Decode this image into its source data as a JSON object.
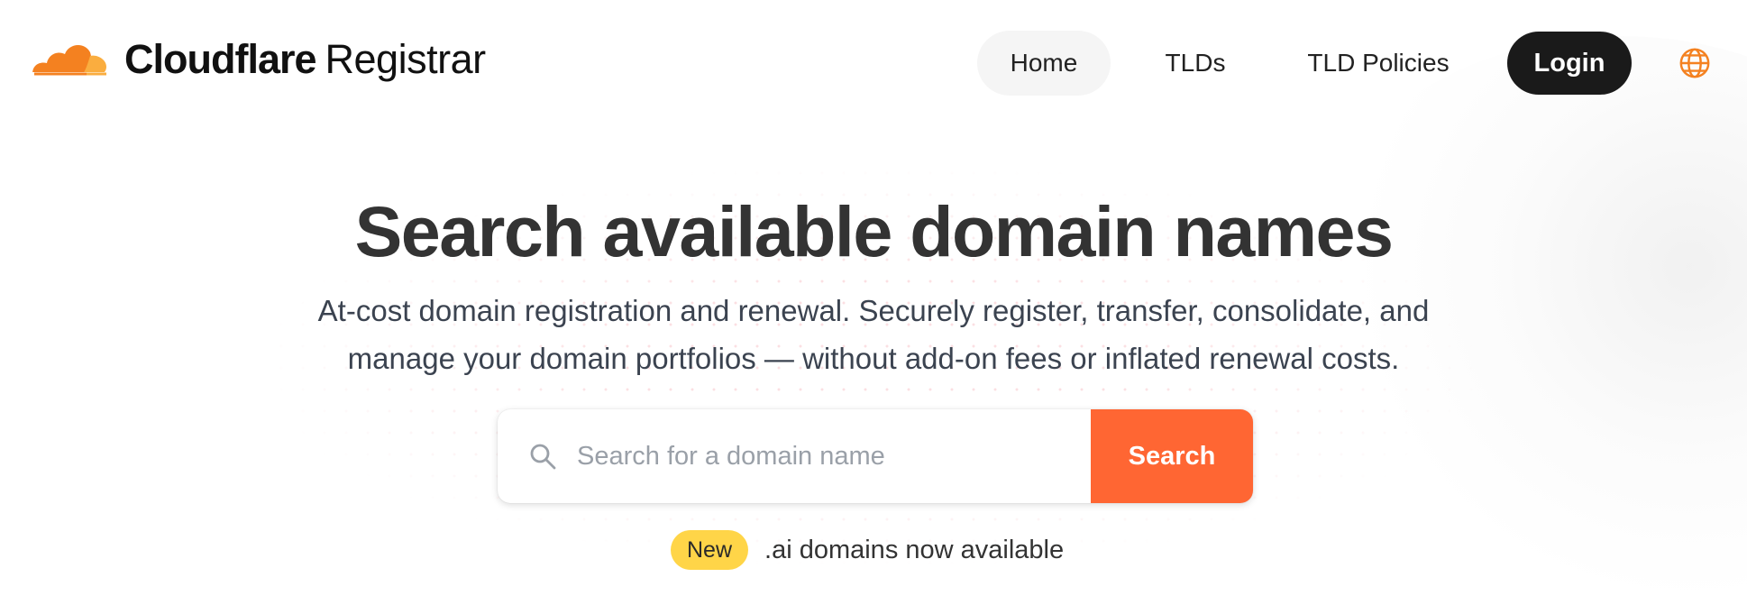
{
  "header": {
    "brand_bold": "Cloudflare",
    "brand_regular": "Registrar",
    "logo_icon": "cloudflare-cloud-logo",
    "nav": [
      {
        "label": "Home",
        "active": true
      },
      {
        "label": "TLDs",
        "active": false
      },
      {
        "label": "TLD Policies",
        "active": false
      }
    ],
    "login_label": "Login",
    "language_icon": "globe-icon"
  },
  "hero": {
    "title": "Search available domain names",
    "subtitle_line1": "At-cost domain registration and renewal. Securely register, transfer, consolidate, and",
    "subtitle_line2": "manage your domain portfolios — without add-on fees or inflated renewal costs."
  },
  "search": {
    "icon": "search-icon",
    "placeholder": "Search for a domain name",
    "value": "",
    "button_label": "Search"
  },
  "promo": {
    "badge": "New",
    "text": ".ai domains now available"
  },
  "colors": {
    "accent_orange": "#ff6633",
    "logo_orange": "#f48120",
    "logo_light_orange": "#faad3f",
    "badge_yellow": "#ffd548",
    "login_bg": "#1a1a1a",
    "title_text": "#333333"
  }
}
